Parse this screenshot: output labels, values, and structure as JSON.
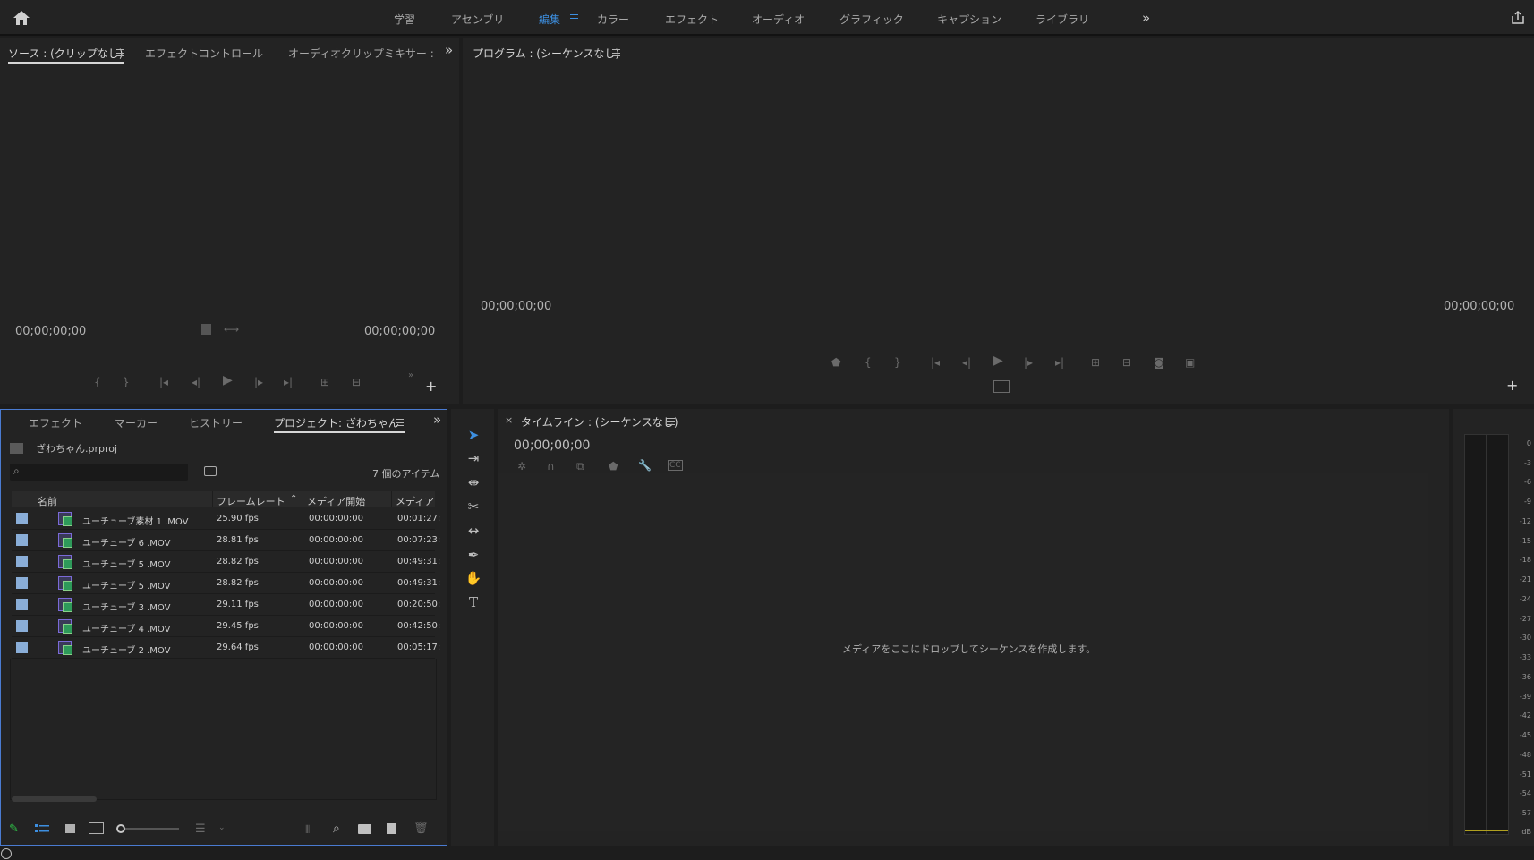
{
  "workspaces": {
    "items": [
      "学習",
      "アセンブリ",
      "編集",
      "カラー",
      "エフェクト",
      "オーディオ",
      "グラフィック",
      "キャプション",
      "ライブラリ"
    ],
    "active_index": 2
  },
  "source_panel": {
    "tabs": [
      "ソース : (クリップなし)",
      "エフェクトコントロール",
      "オーディオクリップミキサー :"
    ],
    "timecode_left": "00;00;00;00",
    "timecode_right": "00;00;00;00"
  },
  "program_panel": {
    "title": "プログラム : (シーケンスなし)",
    "timecode_left": "00;00;00;00",
    "timecode_right": "00;00;00;00"
  },
  "project_panel": {
    "tabs": [
      "エフェクト",
      "マーカー",
      "ヒストリー",
      "プロジェクト: ざわちゃん"
    ],
    "filename": "ざわちゃん.prproj",
    "item_count": "7 個のアイテム",
    "columns": [
      "名前",
      "フレームレート",
      "メディア開始",
      "メディア"
    ],
    "rows": [
      {
        "name": "ユーチューブ素材 1 .MOV",
        "fps": "25.90 fps",
        "start": "00:00:00:00",
        "end": "00:01:27:"
      },
      {
        "name": "ユーチューブ 6 .MOV",
        "fps": "28.81 fps",
        "start": "00:00:00:00",
        "end": "00:07:23:"
      },
      {
        "name": "ユーチューブ 5 .MOV",
        "fps": "28.82 fps",
        "start": "00:00:00:00",
        "end": "00:49:31:"
      },
      {
        "name": "ユーチューブ 5 .MOV",
        "fps": "28.82 fps",
        "start": "00:00:00:00",
        "end": "00:49:31:"
      },
      {
        "name": "ユーチューブ 3 .MOV",
        "fps": "29.11 fps",
        "start": "00:00:00:00",
        "end": "00:20:50:"
      },
      {
        "name": "ユーチューブ 4 .MOV",
        "fps": "29.45 fps",
        "start": "00:00:00:00",
        "end": "00:42:50:"
      },
      {
        "name": "ユーチューブ 2 .MOV",
        "fps": "29.64 fps",
        "start": "00:00:00:00",
        "end": "00:05:17:"
      }
    ]
  },
  "timeline_panel": {
    "close": "×",
    "title": "タイムライン : (シーケンスなし)",
    "timecode": "00;00;00;00",
    "drop_hint": "メディアをここにドロップしてシーケンスを作成します。"
  },
  "audio_meter": {
    "labels": [
      "0",
      "-3",
      "-6",
      "-9",
      "-12",
      "-15",
      "-18",
      "-21",
      "-24",
      "-27",
      "-30",
      "-33",
      "-36",
      "-39",
      "-42",
      "-45",
      "-48",
      "-51",
      "-54",
      "-57",
      "dB"
    ]
  },
  "tools": {
    "icons": [
      "selection-tool-icon",
      "track-select-forward-icon",
      "ripple-edit-icon",
      "razor-icon",
      "slip-icon",
      "pen-icon",
      "hand-icon",
      "type-icon"
    ]
  },
  "colors": {
    "accent": "#3d8fe0",
    "label_swatch": "#8aaed8",
    "panel_focus": "#4a7bd1"
  }
}
